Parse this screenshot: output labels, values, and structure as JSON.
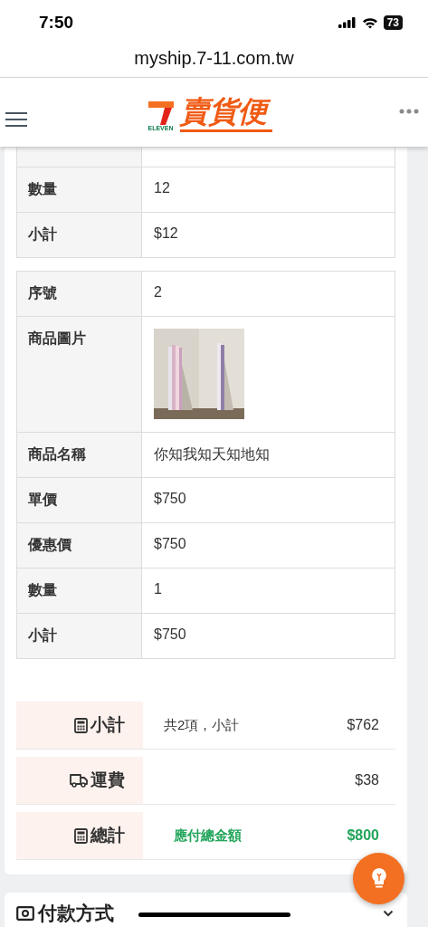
{
  "status_bar": {
    "time": "7:50",
    "battery": "73"
  },
  "browser": {
    "url": "myship.7-11.com.tw"
  },
  "header": {
    "logo_small": "ELEVEN",
    "logo_text": "賣貨便"
  },
  "items": [
    {
      "rows": [
        {
          "kind": "text",
          "label": "數量",
          "value": "12"
        },
        {
          "kind": "text",
          "label": "小計",
          "value": "$12"
        }
      ]
    },
    {
      "rows": [
        {
          "kind": "text",
          "label": "序號",
          "value": "2"
        },
        {
          "kind": "picture",
          "label": "商品圖片"
        },
        {
          "kind": "text",
          "label": "商品名稱",
          "value": "你知我知天知地知"
        },
        {
          "kind": "text",
          "label": "單價",
          "value": "$750"
        },
        {
          "kind": "text",
          "label": "優惠價",
          "value": "$750"
        },
        {
          "kind": "text",
          "label": "數量",
          "value": "1"
        },
        {
          "kind": "text",
          "label": "小計",
          "value": "$750"
        }
      ]
    }
  ],
  "summary": [
    {
      "kind": "calculator",
      "label": "小計",
      "note": "共2項，小計",
      "amount": "$762",
      "highlight": false
    },
    {
      "kind": "truck",
      "label": "運費",
      "amount": "$38",
      "highlight": false
    },
    {
      "kind": "calculator",
      "label": "總計",
      "note": "應付總金額",
      "amount": "$800",
      "highlight": true
    }
  ],
  "payment": {
    "title": "付款方式"
  }
}
